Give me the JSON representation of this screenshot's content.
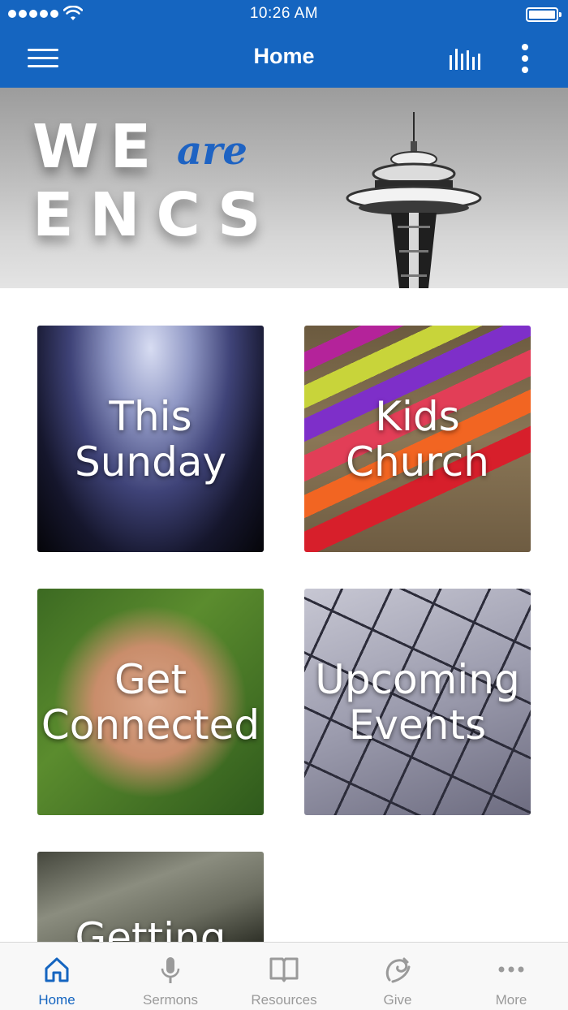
{
  "status_bar": {
    "time": "10:26 AM"
  },
  "nav": {
    "title": "Home"
  },
  "banner": {
    "line1": "WE",
    "accent": "are",
    "line2": "ENCS"
  },
  "tiles": [
    {
      "label": "This\nSunday"
    },
    {
      "label": "Kids\nChurch"
    },
    {
      "label": "Get\nConnected"
    },
    {
      "label": "Upcoming\nEvents"
    },
    {
      "label": "Getting"
    }
  ],
  "tabbar": {
    "items": [
      {
        "label": "Home",
        "icon": "home-icon",
        "active": true
      },
      {
        "label": "Sermons",
        "icon": "microphone-icon",
        "active": false
      },
      {
        "label": "Resources",
        "icon": "book-icon",
        "active": false
      },
      {
        "label": "Give",
        "icon": "give-icon",
        "active": false
      },
      {
        "label": "More",
        "icon": "ellipsis-icon",
        "active": false
      }
    ]
  },
  "colors": {
    "brand": "#1565c0",
    "tab_inactive": "#9a9a9a",
    "accent_text": "#1e63c3"
  }
}
